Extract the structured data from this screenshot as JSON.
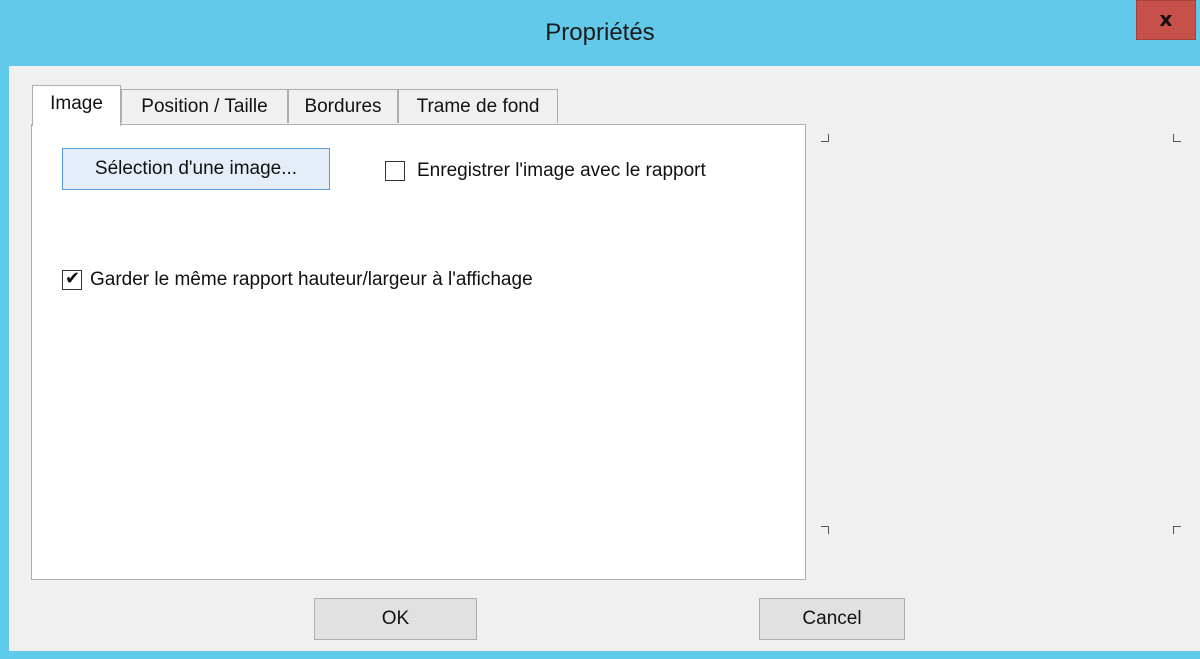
{
  "window": {
    "title": "Propriétés",
    "close_label": "x"
  },
  "tabs": [
    {
      "label": "Image",
      "active": true
    },
    {
      "label": "Position / Taille",
      "active": false
    },
    {
      "label": "Bordures",
      "active": false
    },
    {
      "label": "Trame de fond",
      "active": false
    }
  ],
  "image_tab": {
    "select_image_label": "Sélection d'une image...",
    "save_with_report": {
      "label": "Enregistrer l'image avec le rapport",
      "checked": false
    },
    "keep_aspect_ratio": {
      "label": "Garder le même rapport hauteur/largeur à l'affichage",
      "checked": true
    }
  },
  "footer": {
    "ok_label": "OK",
    "cancel_label": "Cancel"
  },
  "colors": {
    "titlebar": "#62c9ea",
    "close_button": "#c7504a",
    "client_background": "#f0f0f0"
  }
}
